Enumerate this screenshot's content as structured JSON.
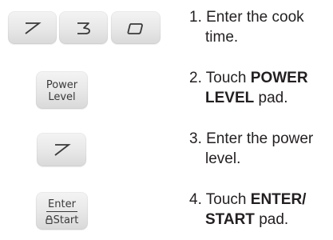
{
  "keypad": {
    "digit_keys": [
      "7",
      "3",
      "0"
    ],
    "power_level_key": [
      "Power",
      "Level"
    ],
    "level_key": "7",
    "enter_start_key": {
      "top": "Enter",
      "bottom": "Start"
    }
  },
  "steps": [
    {
      "line1_plain": "1. Enter the cook",
      "line2_plain": "time."
    },
    {
      "line1_plain": "2. Touch ",
      "line1_bold": "POWER",
      "line2_bold": "LEVEL",
      "line2_plain": " pad."
    },
    {
      "line1_plain": "3. Enter the power",
      "line2_plain": "level."
    },
    {
      "line1_plain": "4. Touch ",
      "line1_bold": "ENTER/",
      "line2_bold": "START",
      "line2_plain": " pad."
    }
  ],
  "colors": {
    "text": "#231f20",
    "key_face": "#e7e7e7",
    "key_glyph": "#3a3a3a"
  },
  "icons": {
    "lock": "lock-icon"
  }
}
